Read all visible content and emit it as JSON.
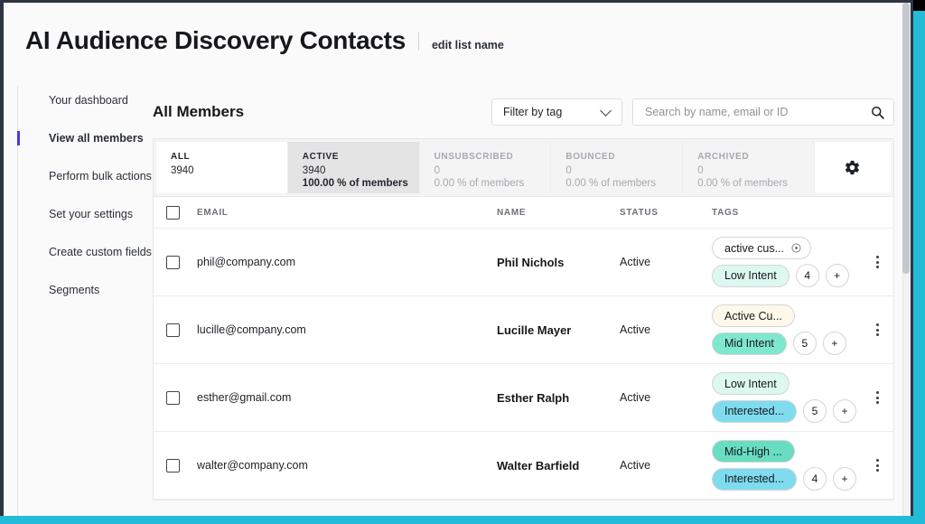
{
  "header": {
    "title": "AI Audience Discovery Contacts",
    "edit_link": "edit list name"
  },
  "sidebar": {
    "items": [
      {
        "label": "Your dashboard",
        "active": false
      },
      {
        "label": "View all members",
        "active": true
      },
      {
        "label": "Perform bulk actions",
        "active": false
      },
      {
        "label": "Set your settings",
        "active": false
      },
      {
        "label": "Create custom fields",
        "active": false
      },
      {
        "label": "Segments",
        "active": false
      }
    ],
    "active_indicator_color": "#4b36e8"
  },
  "toolbar": {
    "heading": "All Members",
    "filter_label": "Filter by tag",
    "search_placeholder": "Search by name, email or ID",
    "search_value": ""
  },
  "stats": [
    {
      "label": "ALL",
      "value": "3940",
      "pct": "",
      "state": "all"
    },
    {
      "label": "ACTIVE",
      "value": "3940",
      "pct": "100.00 % of members",
      "state": "active"
    },
    {
      "label": "UNSUBSCRIBED",
      "value": "0",
      "pct": "0.00 % of members",
      "state": "muted"
    },
    {
      "label": "BOUNCED",
      "value": "0",
      "pct": "0.00 % of members",
      "state": "muted"
    },
    {
      "label": "ARCHIVED",
      "value": "0",
      "pct": "0.00 % of members",
      "state": "muted"
    }
  ],
  "table": {
    "columns": {
      "email": "EMAIL",
      "name": "NAME",
      "status": "STATUS",
      "tags": "TAGS"
    },
    "rows": [
      {
        "email": "phil@company.com",
        "name": "Phil Nichols",
        "status": "Active",
        "tag_top": "active cus...",
        "tag_top_color": "#ffffff",
        "tag_top_removable": true,
        "tag_bottom": "Low Intent",
        "tag_bottom_color": "#ddf8ef",
        "count": "4",
        "add": "+"
      },
      {
        "email": "lucille@company.com",
        "name": "Lucille Mayer",
        "status": "Active",
        "tag_top": "Active Cu...",
        "tag_top_color": "#fdf8ea",
        "tag_top_removable": false,
        "tag_bottom": "Mid Intent",
        "tag_bottom_color": "#7fe7ce",
        "count": "5",
        "add": "+"
      },
      {
        "email": "esther@gmail.com",
        "name": "Esther Ralph",
        "status": "Active",
        "tag_top": "Low Intent",
        "tag_top_color": "#ddf8ef",
        "tag_top_removable": false,
        "tag_bottom": "Interested...",
        "tag_bottom_color": "#7fdcef",
        "count": "5",
        "add": "+"
      },
      {
        "email": "walter@company.com",
        "name": "Walter Barfield",
        "status": "Active",
        "tag_top": "Mid-High ...",
        "tag_top_color": "#68ddc2",
        "tag_top_removable": false,
        "tag_bottom": "Interested...",
        "tag_bottom_color": "#7fdcef",
        "count": "4",
        "add": "+"
      }
    ]
  },
  "icons": {
    "search": "search-icon",
    "gear": "gear-icon",
    "kebab": "kebab-menu-icon",
    "chevron": "chevron-down-icon",
    "remove_tag": "remove-tag-icon"
  },
  "chrome": {
    "frame_color": "#2e3443",
    "accent_color": "#22bcd8"
  }
}
